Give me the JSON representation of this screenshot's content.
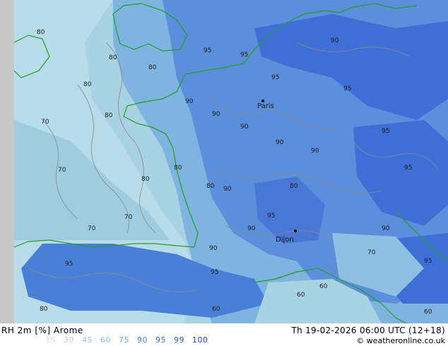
{
  "header": {
    "parameter": "RH 2m [%]",
    "model": "Arome",
    "valid_time": "Th 19-02-2026 06:00 UTC (12+18)",
    "credit": "© weatheronline.co.uk"
  },
  "legend": {
    "values": [
      {
        "label": "15",
        "color": "#cfe1ef"
      },
      {
        "label": "30",
        "color": "#b5cfe6"
      },
      {
        "label": "45",
        "color": "#9bbedc"
      },
      {
        "label": "60",
        "color": "#82c3e3"
      },
      {
        "label": "75",
        "color": "#6faedb"
      },
      {
        "label": "90",
        "color": "#4c87d6"
      },
      {
        "label": "95",
        "color": "#3f6fd2"
      },
      {
        "label": "99",
        "color": "#2f5ccc"
      },
      {
        "label": "100",
        "color": "#2149c4"
      }
    ]
  },
  "map": {
    "cities": [
      {
        "name": "Paris"
      },
      {
        "name": "Dijon"
      }
    ],
    "contour_labels": [
      {
        "value": "70"
      },
      {
        "value": "70"
      },
      {
        "value": "70"
      },
      {
        "value": "70"
      },
      {
        "value": "70"
      },
      {
        "value": "80"
      },
      {
        "value": "80"
      },
      {
        "value": "80"
      },
      {
        "value": "80"
      },
      {
        "value": "80"
      },
      {
        "value": "80"
      },
      {
        "value": "80"
      },
      {
        "value": "80"
      },
      {
        "value": "80"
      },
      {
        "value": "80"
      },
      {
        "value": "90"
      },
      {
        "value": "90"
      },
      {
        "value": "90"
      },
      {
        "value": "90"
      },
      {
        "value": "90"
      },
      {
        "value": "90"
      },
      {
        "value": "90"
      },
      {
        "value": "90"
      },
      {
        "value": "90"
      },
      {
        "value": "90"
      },
      {
        "value": "95"
      },
      {
        "value": "95"
      },
      {
        "value": "95"
      },
      {
        "value": "95"
      },
      {
        "value": "95"
      },
      {
        "value": "95"
      },
      {
        "value": "95"
      },
      {
        "value": "95"
      },
      {
        "value": "95"
      },
      {
        "value": "95"
      },
      {
        "value": "60"
      },
      {
        "value": "60"
      },
      {
        "value": "60"
      },
      {
        "value": "60"
      }
    ]
  }
}
